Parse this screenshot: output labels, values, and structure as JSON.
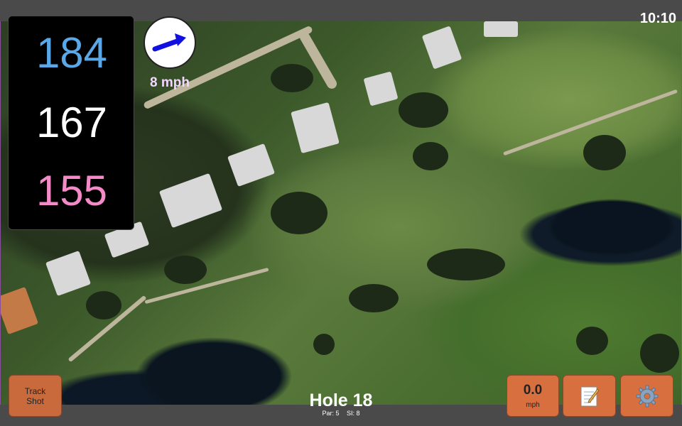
{
  "status_bar": {
    "time": "10:10"
  },
  "distances": {
    "back": "184",
    "middle": "167",
    "front": "155"
  },
  "wind": {
    "speed_label": "8 mph",
    "direction_icon": "arrow-icon"
  },
  "hole": {
    "title": "Hole 18",
    "par_label": "Par: 5",
    "si_label": "SI: 8"
  },
  "buttons": {
    "track_shot_line1": "Track",
    "track_shot_line2": "Shot",
    "speed_value": "0.0",
    "speed_unit": "mph",
    "notes_icon": "notepad-icon",
    "settings_icon": "gear-icon"
  },
  "colors": {
    "back_distance": "#5aa8e8",
    "middle_distance": "#ffffff",
    "front_distance": "#f58ac8",
    "button_accent": "#d86f3f",
    "wind_arrow": "#1010e0"
  }
}
